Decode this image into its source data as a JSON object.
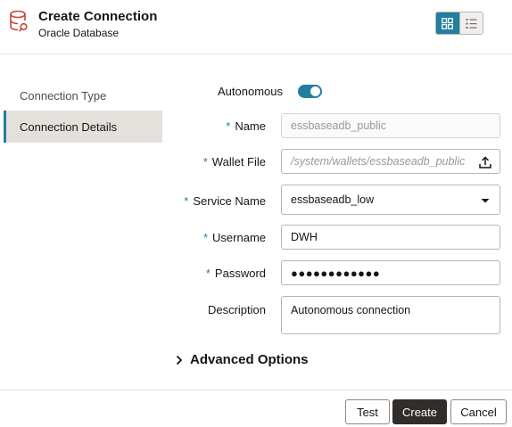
{
  "header": {
    "title": "Create Connection",
    "subtitle": "Oracle Database",
    "icon": "database-icon",
    "accent_color": "#c74634",
    "view_toggle": {
      "grid_icon": "grid-view-icon",
      "list_icon": "list-view-icon",
      "active": "grid"
    }
  },
  "nav": {
    "items": [
      {
        "label": "Connection Type",
        "selected": false
      },
      {
        "label": "Connection Details",
        "selected": true
      }
    ]
  },
  "form": {
    "required_marker": "*",
    "autonomous": {
      "label": "Autonomous",
      "on": true
    },
    "name": {
      "label": "Name",
      "placeholder": "essbaseadb_public",
      "readonly": true
    },
    "wallet_file": {
      "label": "Wallet File",
      "placeholder": "/system/wallets/essbaseadb_public",
      "icon": "upload-icon"
    },
    "service_name": {
      "label": "Service Name",
      "value": "essbaseadb_low",
      "icon": "caret-down-icon"
    },
    "username": {
      "label": "Username",
      "value": "DWH"
    },
    "password": {
      "label": "Password",
      "value": "●●●●●●●●●●●●"
    },
    "description": {
      "label": "Description",
      "value": "Autonomous connection"
    },
    "advanced": {
      "label": "Advanced Options",
      "expanded": false,
      "icon": "chevron-right-icon"
    }
  },
  "footer": {
    "test_label": "Test",
    "create_label": "Create",
    "cancel_label": "Cancel"
  },
  "colors": {
    "primary": "#227e9e",
    "dark_button": "#312d2a",
    "selected_nav_bg": "#e4e1dd"
  }
}
